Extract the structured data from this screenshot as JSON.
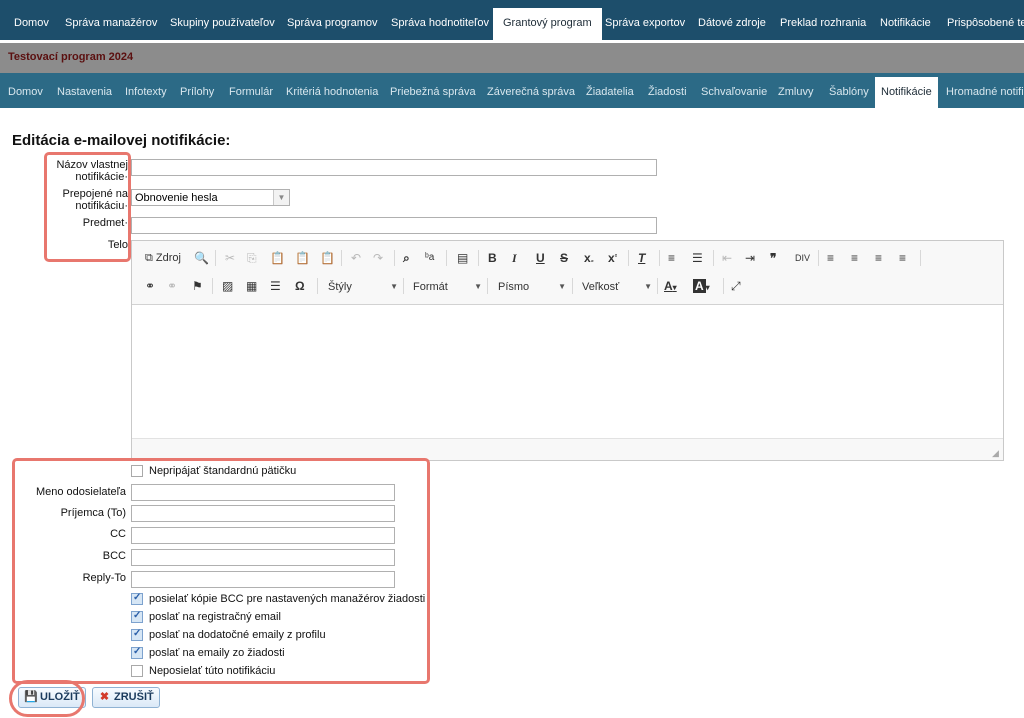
{
  "topnav": {
    "items": [
      "Domov",
      "Správa manažérov",
      "Skupiny používateľov",
      "Správa programov",
      "Správa hodnotiteľov",
      "Grantový program",
      "Správa exportov",
      "Dátové zdroje",
      "Preklad rozhrania",
      "Notifikácie",
      "Prispôsobené tex"
    ],
    "active": "Grantový program"
  },
  "program_title": "Testovací program 2024",
  "subnav": {
    "items": [
      "Domov",
      "Nastavenia",
      "Infotexty",
      "Prílohy",
      "Formulár",
      "Kritériá hodnotenia",
      "Priebežná správa",
      "Záverečná správa",
      "Žiadatelia",
      "Žiadosti",
      "Schvaľovanie",
      "Zmluvy",
      "Šablóny",
      "Notifikácie",
      "Hromadné notifi"
    ],
    "active": "Notifikácie"
  },
  "page_title": "Editácia e-mailovej notifikácie:",
  "form": {
    "name_label_1": "Názov vlastnej",
    "name_label_2": "notifikácie",
    "name_value": "",
    "linked_label_1": "Prepojené na",
    "linked_label_2": "notifikáciu",
    "linked_value": "Obnovenie hesla",
    "subject_label": "Predmet",
    "subject_value": "",
    "body_label": "Telo",
    "required_mark": "·"
  },
  "editor": {
    "source_label": "Zdroj",
    "styles_label": "Štýly",
    "format_label": "Formát",
    "font_label": "Písmo",
    "size_label": "Veľkosť"
  },
  "footer_checkbox": {
    "label": "Nepripájať štandardnú pätičku",
    "checked": false
  },
  "sender": {
    "name_label": "Meno odosielateľa",
    "to_label": "Príjemca (To)",
    "cc_label": "CC",
    "bcc_label": "BCC",
    "replyto_label": "Reply-To"
  },
  "options": [
    {
      "label": "posielať kópie BCC pre nastavených manažérov žiadosti",
      "checked": true
    },
    {
      "label": "poslať na registračný email",
      "checked": true
    },
    {
      "label": "poslať na dodatočné emaily z profilu",
      "checked": true
    },
    {
      "label": "poslať na emaily zo žiadosti",
      "checked": true
    },
    {
      "label": "Neposielať túto notifikáciu",
      "checked": false
    }
  ],
  "buttons": {
    "save": "ULOŽIŤ",
    "cancel": "ZRUŠIŤ"
  },
  "colors": {
    "topnav": "#1d4e6b",
    "subnav": "#2c6a86",
    "program_bar": "#8c8c8c",
    "highlight": "#e8776e"
  }
}
